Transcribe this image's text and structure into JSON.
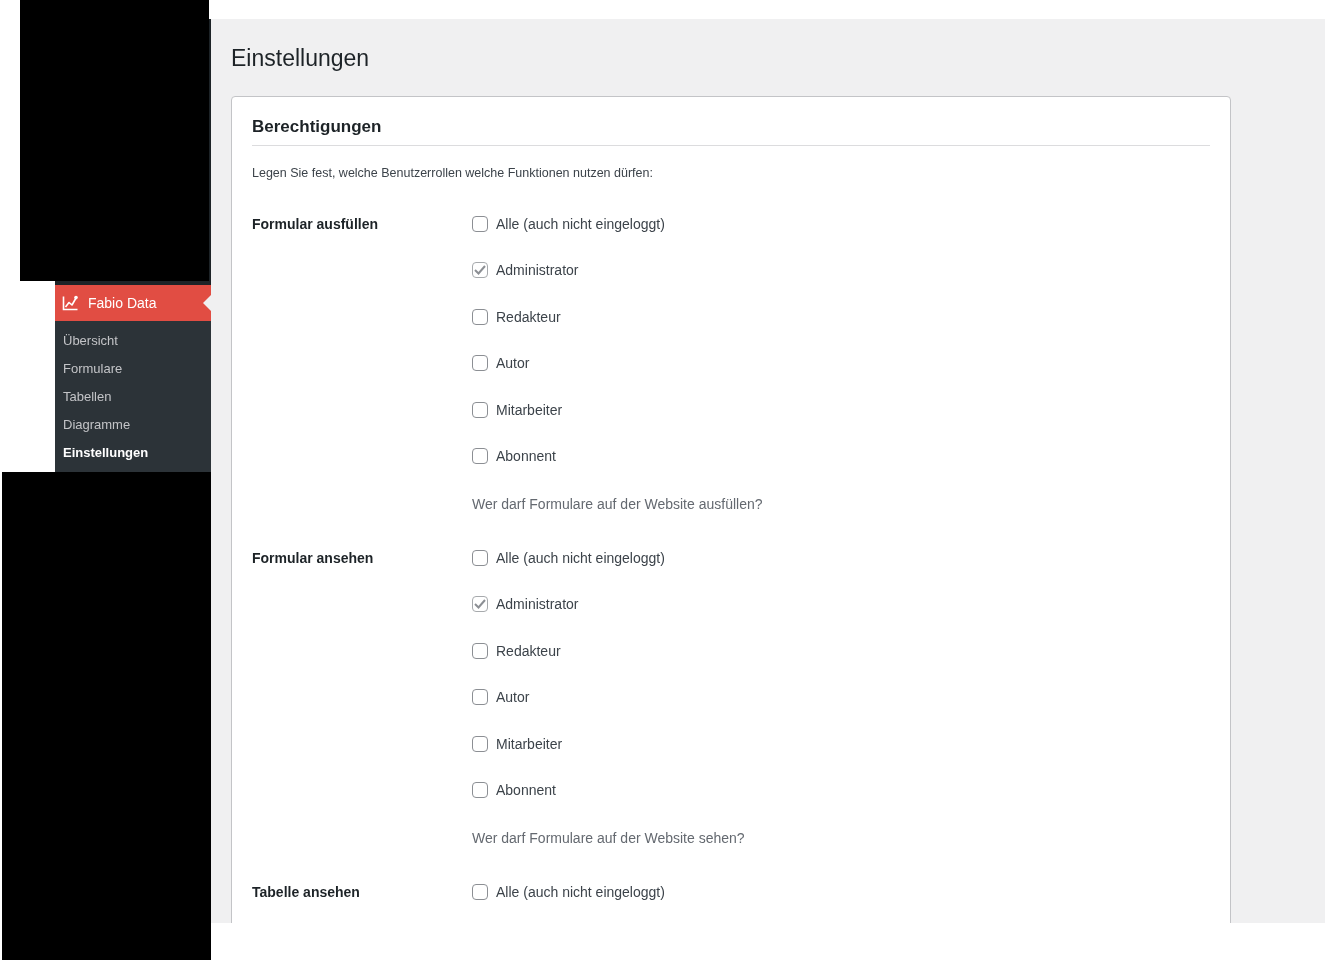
{
  "page": {
    "title": "Einstellungen"
  },
  "sidebar": {
    "menu": {
      "label": "Fabio Data",
      "current": true
    },
    "items": [
      {
        "label": "Übersicht",
        "selected": false
      },
      {
        "label": "Formulare",
        "selected": false
      },
      {
        "label": "Tabellen",
        "selected": false
      },
      {
        "label": "Diagramme",
        "selected": false
      },
      {
        "label": "Einstellungen",
        "selected": true
      }
    ]
  },
  "card": {
    "title": "Berechtigungen",
    "intro": "Legen Sie fest, welche Benutzerrollen welche Funktionen nutzen dürfen:",
    "permissions": [
      {
        "label": "Formular ausfüllen",
        "options": [
          {
            "label": "Alle (auch nicht eingeloggt)",
            "checked": false,
            "disabled": false
          },
          {
            "label": "Administrator",
            "checked": true,
            "disabled": true
          },
          {
            "label": "Redakteur",
            "checked": false,
            "disabled": false
          },
          {
            "label": "Autor",
            "checked": false,
            "disabled": false
          },
          {
            "label": "Mitarbeiter",
            "checked": false,
            "disabled": false
          },
          {
            "label": "Abonnent",
            "checked": false,
            "disabled": false
          }
        ],
        "description": "Wer darf Formulare auf der Website ausfüllen?"
      },
      {
        "label": "Formular ansehen",
        "options": [
          {
            "label": "Alle (auch nicht eingeloggt)",
            "checked": false,
            "disabled": false
          },
          {
            "label": "Administrator",
            "checked": true,
            "disabled": true
          },
          {
            "label": "Redakteur",
            "checked": false,
            "disabled": false
          },
          {
            "label": "Autor",
            "checked": false,
            "disabled": false
          },
          {
            "label": "Mitarbeiter",
            "checked": false,
            "disabled": false
          },
          {
            "label": "Abonnent",
            "checked": false,
            "disabled": false
          }
        ],
        "description": "Wer darf Formulare auf der Website sehen?"
      },
      {
        "label": "Tabelle ansehen",
        "options": [
          {
            "label": "Alle (auch nicht eingeloggt)",
            "checked": false,
            "disabled": false
          }
        ]
      }
    ]
  }
}
